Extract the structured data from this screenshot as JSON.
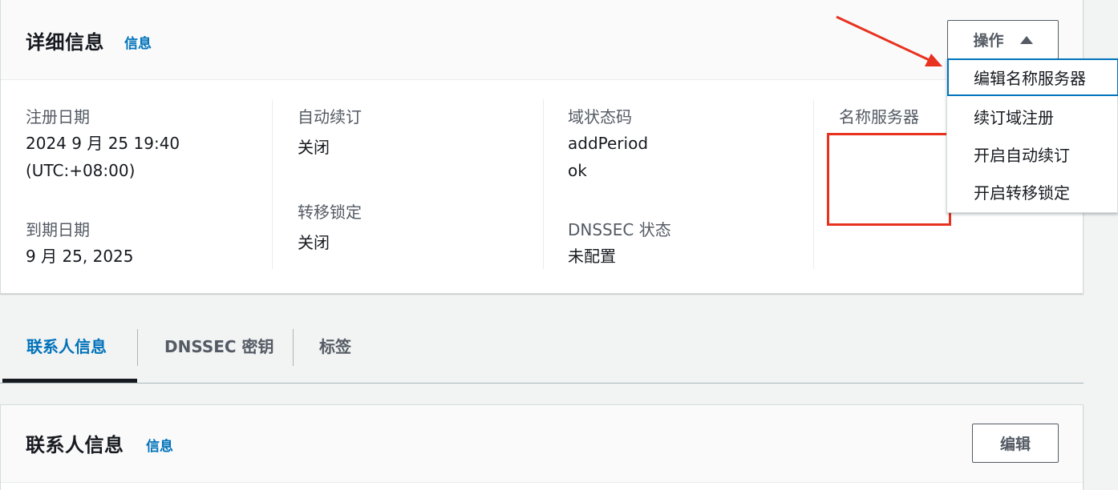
{
  "details": {
    "title": "详细信息",
    "info_link": "信息",
    "actions_label": "操作",
    "registration_date_label": "注册日期",
    "registration_date_line1": "2024 9 月 25 19:40",
    "registration_date_line2": "(UTC:+08:00)",
    "expiration_date_label": "到期日期",
    "expiration_date_value": "9 月 25, 2025",
    "auto_renew_label": "自动续订",
    "auto_renew_value": "关闭",
    "transfer_lock_label": "转移锁定",
    "transfer_lock_value": "关闭",
    "domain_status_label": "域状态码",
    "domain_status_values": [
      "addPeriod",
      "ok"
    ],
    "dnssec_status_label": "DNSSEC 状态",
    "dnssec_status_value": "未配置",
    "name_servers_label": "名称服务器"
  },
  "actions_menu": {
    "items": [
      {
        "label": "编辑名称服务器",
        "active": true
      },
      {
        "label": "续订域注册",
        "active": false
      },
      {
        "label": "开启自动续订",
        "active": false
      },
      {
        "label": "开启转移锁定",
        "active": false
      }
    ]
  },
  "tabs": [
    {
      "label": "联系人信息",
      "active": true
    },
    {
      "label": "DNSSEC 密钥",
      "active": false
    },
    {
      "label": "标签",
      "active": false
    }
  ],
  "contact": {
    "title": "联系人信息",
    "info_link": "信息",
    "edit_label": "编辑"
  },
  "colors": {
    "accent": "#0073bb",
    "annotation": "#e8321f",
    "text": "#16191f",
    "muted": "#545b64"
  },
  "icons": {
    "actions_caret": "caret-up-icon"
  }
}
